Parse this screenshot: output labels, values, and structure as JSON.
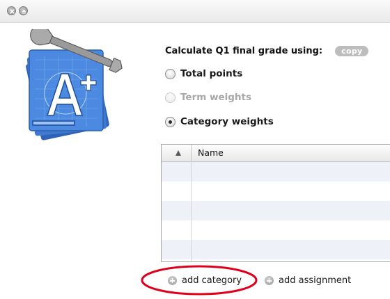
{
  "window": {
    "controls": [
      {
        "name": "close",
        "icon": "close-icon"
      },
      {
        "name": "minimize",
        "icon": "eject-icon"
      }
    ]
  },
  "logo": {
    "icon": "grade-setup-tools-logo-icon"
  },
  "options": {
    "heading": "Calculate Q1 final grade using:",
    "copy_label": "copy",
    "radios": [
      {
        "label": "Total points",
        "selected": false,
        "enabled": true
      },
      {
        "label": "Term weights",
        "selected": false,
        "enabled": false
      },
      {
        "label": "Category weights",
        "selected": true,
        "enabled": true
      }
    ]
  },
  "table": {
    "columns": [
      "",
      "Name"
    ],
    "sort_indicator": "ascending",
    "rows": []
  },
  "actions": {
    "add_category": "add category",
    "add_assignment": "add assignment"
  },
  "colors": {
    "highlight": "#e0001b",
    "row_alt": "#eef2f8",
    "logo_blue": "#3a7bd5"
  }
}
